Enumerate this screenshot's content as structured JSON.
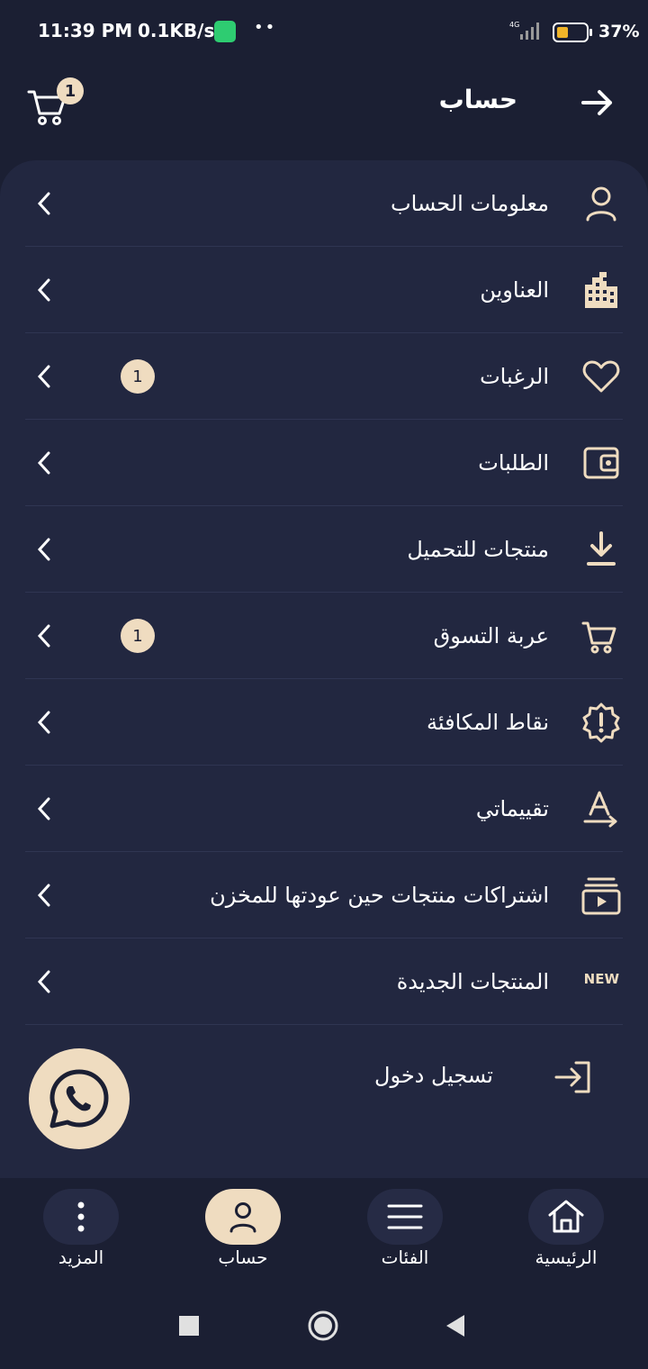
{
  "status": {
    "time": "11:39 PM",
    "speed": "0.1KB/s",
    "network": "4G",
    "battery": "37%"
  },
  "header": {
    "title": "حساب",
    "cart_count": "1"
  },
  "menu": [
    {
      "label": "معلومات الحساب",
      "icon": "user-icon"
    },
    {
      "label": "العناوين",
      "icon": "building-icon"
    },
    {
      "label": "الرغبات",
      "icon": "heart-icon",
      "badge": "1"
    },
    {
      "label": "الطلبات",
      "icon": "wallet-icon"
    },
    {
      "label": "منتجات للتحميل",
      "icon": "download-icon"
    },
    {
      "label": "عربة التسوق",
      "icon": "cart-icon",
      "badge": "1"
    },
    {
      "label": "نقاط المكافئة",
      "icon": "reward-badge-icon"
    },
    {
      "label": "تقييماتي",
      "icon": "rating-icon"
    },
    {
      "label": "اشتراكات منتجات حين عودتها للمخزن",
      "icon": "subscription-icon"
    },
    {
      "label": "المنتجات الجديدة",
      "icon": "new-icon",
      "tag": "NEW"
    }
  ],
  "login": {
    "label": "تسجيل دخول"
  },
  "bottom_nav": [
    {
      "label": "الرئيسية",
      "icon": "home-icon"
    },
    {
      "label": "الفئات",
      "icon": "menu-icon"
    },
    {
      "label": "حساب",
      "icon": "user-icon",
      "active": true
    },
    {
      "label": "المزيد",
      "icon": "more-icon"
    }
  ],
  "colors": {
    "background": "#1b1f33",
    "panel": "#222740",
    "accent": "#efdcc0"
  }
}
